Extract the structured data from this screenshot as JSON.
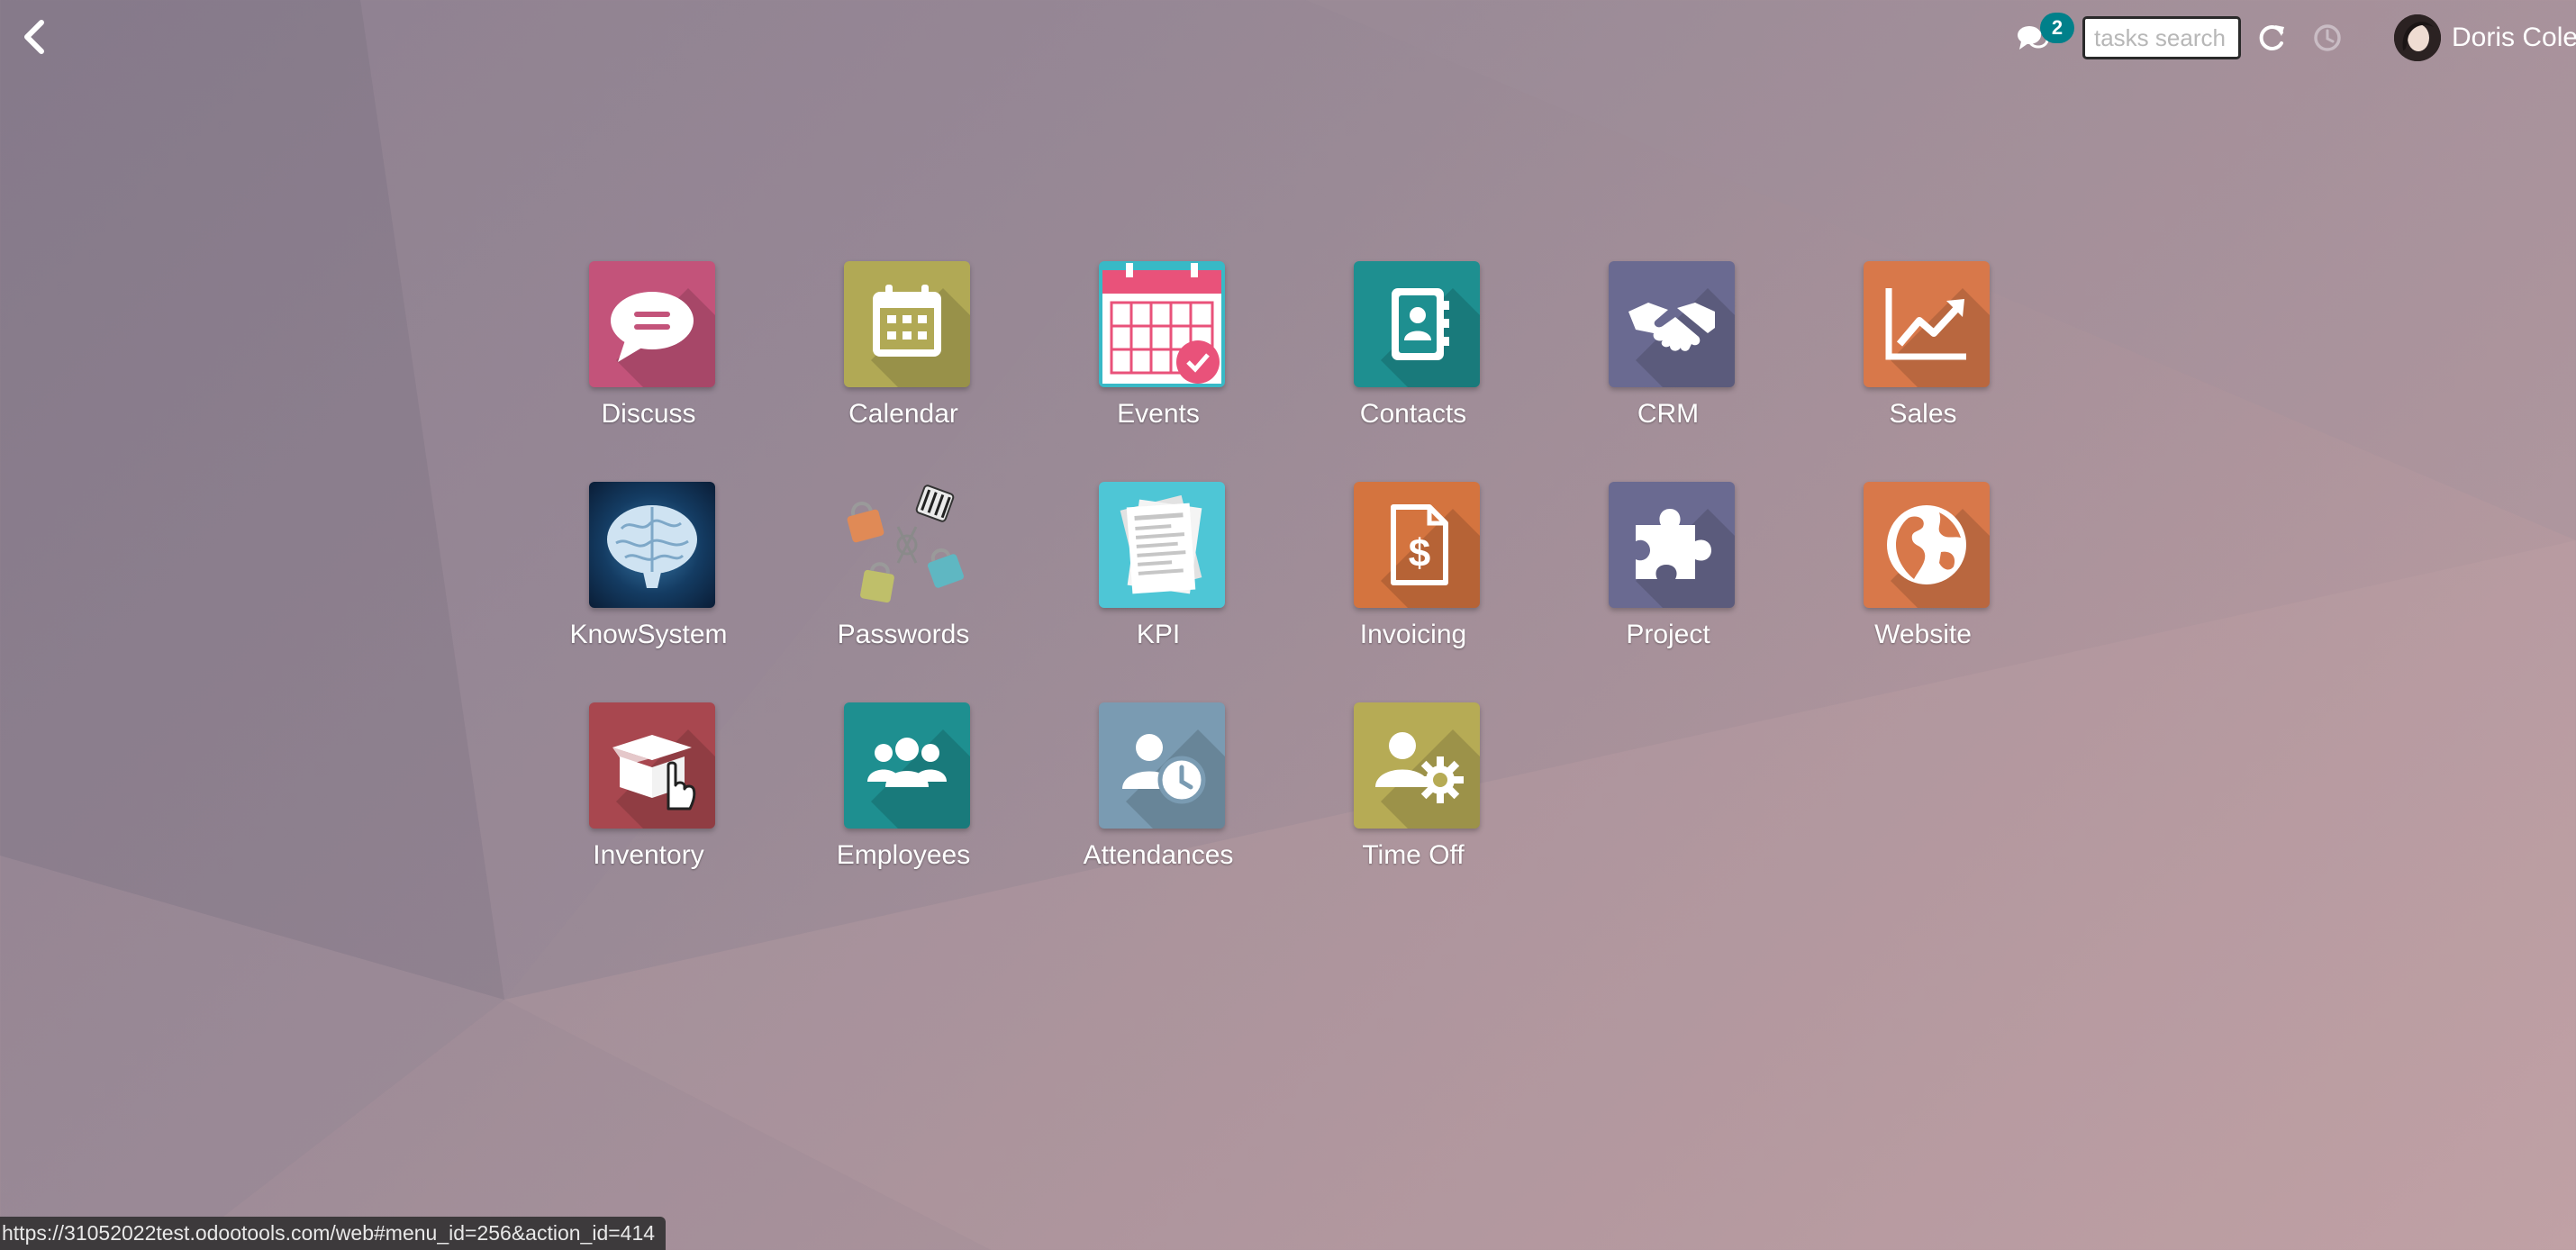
{
  "user": {
    "name": "Doris Cole"
  },
  "messages": {
    "unread_count": "2"
  },
  "search": {
    "placeholder": "tasks search",
    "value": ""
  },
  "apps": [
    {
      "label": "Discuss",
      "color": "#c3537a",
      "icon": "discuss-icon"
    },
    {
      "label": "Calendar",
      "color": "#b1a955",
      "icon": "calendar-icon"
    },
    {
      "label": "Events",
      "color": "#38b9c6",
      "icon": "events-icon"
    },
    {
      "label": "Contacts",
      "color": "#1e8f90",
      "icon": "contacts-icon"
    },
    {
      "label": "CRM",
      "color": "#6a6a91",
      "icon": "crm-icon"
    },
    {
      "label": "Sales",
      "color": "#d8784a",
      "icon": "sales-icon"
    },
    {
      "label": "KnowSystem",
      "color": "#0c2e4e",
      "icon": "knowsystem-brain-icon"
    },
    {
      "label": "Passwords",
      "color": "#a99ca3",
      "icon": "passwords-padlocks-icon"
    },
    {
      "label": "KPI",
      "color": "#4ec6d6",
      "icon": "kpi-papers-icon"
    },
    {
      "label": "Invoicing",
      "color": "#d4743f",
      "icon": "invoicing-icon"
    },
    {
      "label": "Project",
      "color": "#6a6a91",
      "icon": "project-icon"
    },
    {
      "label": "Website",
      "color": "#d8784a",
      "icon": "website-icon"
    },
    {
      "label": "Inventory",
      "color": "#a8474f",
      "icon": "inventory-icon"
    },
    {
      "label": "Employees",
      "color": "#1e8f90",
      "icon": "employees-icon"
    },
    {
      "label": "Attendances",
      "color": "#7a9bb2",
      "icon": "attendances-icon"
    },
    {
      "label": "Time Off",
      "color": "#b6ab55",
      "icon": "time-off-icon"
    }
  ],
  "status_bar": {
    "url": "https://31052022test.odootools.com/web#menu_id=256&action_id=414"
  }
}
